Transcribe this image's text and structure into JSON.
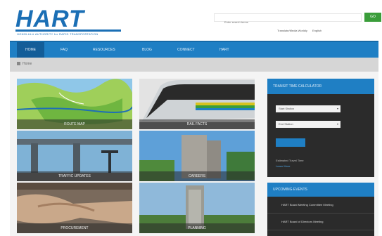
{
  "header": {
    "logo_text": "HART",
    "logo_tagline": "HONOLULU AUTHORITY for RAPID TRANSPORTATION",
    "search_placeholder": "Enter search terms",
    "search_button": "GO",
    "util_links": [
      "Translate/Media Worldly",
      "English"
    ]
  },
  "nav": {
    "items": [
      "HOME",
      "FAQ",
      "RESOURCES",
      "BLOG",
      "CONNECT",
      "HART"
    ],
    "active_index": 0
  },
  "breadcrumb": {
    "home": "Home"
  },
  "tiles": [
    {
      "label": "ROUTE MAP"
    },
    {
      "label": "RAIL FACTS"
    },
    {
      "label": "TRAFFIC UPDATES"
    },
    {
      "label": "CAREERS"
    },
    {
      "label": "PROCUREMENT"
    },
    {
      "label": "PLANNING"
    }
  ],
  "calculator": {
    "title": "TRANSIT TIME CALCULATOR",
    "origin_placeholder": "Start Station",
    "destination_placeholder": "End Station",
    "note": "Estimated Travel Time",
    "link": "Learn More"
  },
  "events": {
    "title": "UPCOMING EVENTS",
    "items": [
      "HART Board Meeting Committee Meeting",
      "HART Board of Directors Meeting"
    ]
  },
  "colors": {
    "brand_blue": "#1f7fc4",
    "go_green": "#3a9d3a",
    "sidebar_dark": "#2b2b2b"
  }
}
